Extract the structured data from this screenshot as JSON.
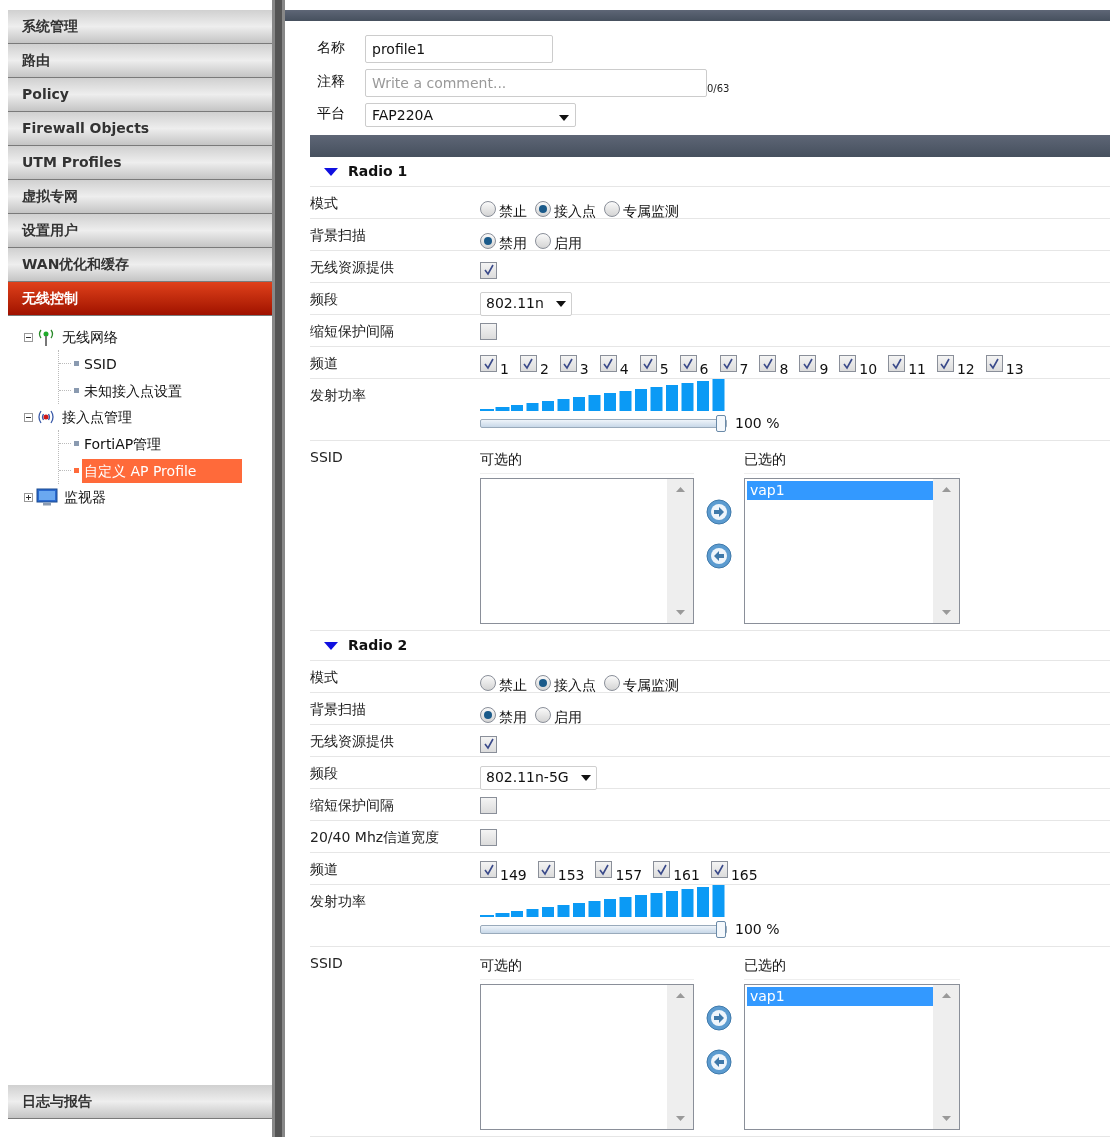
{
  "sidebar": {
    "menu": [
      {
        "label": "系统管理",
        "selected": false
      },
      {
        "label": "路由",
        "selected": false
      },
      {
        "label": "Policy",
        "selected": false
      },
      {
        "label": "Firewall Objects",
        "selected": false
      },
      {
        "label": "UTM Profiles",
        "selected": false
      },
      {
        "label": "虚拟专网",
        "selected": false
      },
      {
        "label": "设置用户",
        "selected": false
      },
      {
        "label": "WAN优化和缓存",
        "selected": false
      },
      {
        "label": "无线控制",
        "selected": true
      }
    ],
    "tree": [
      {
        "label": "无线网络",
        "kind": "antenna",
        "expanded": true,
        "children": [
          {
            "label": "SSID",
            "selected": false
          },
          {
            "label": "未知接入点设置",
            "selected": false
          }
        ]
      },
      {
        "label": "接入点管理",
        "kind": "ap",
        "expanded": true,
        "children": [
          {
            "label": "FortiAP管理",
            "selected": false
          },
          {
            "label": "自定义 AP Profile",
            "selected": true
          }
        ]
      },
      {
        "label": "监视器",
        "kind": "monitor",
        "expanded": false
      }
    ],
    "bottom_menu": [
      {
        "label": "日志与报告",
        "selected": false
      }
    ]
  },
  "form": {
    "name_label": "名称",
    "name_value": "profile1",
    "comment_label": "注释",
    "comment_placeholder": "Write a comment...",
    "comment_counter": "0/63",
    "platform_label": "平台",
    "platform_value": "FAP220A"
  },
  "radios": [
    {
      "title": "Radio 1",
      "expanded": true,
      "rows": [
        {
          "kind": "radio",
          "label": "模式",
          "options": [
            {
              "label": "禁止",
              "selected": false
            },
            {
              "label": "接入点",
              "selected": true
            },
            {
              "label": "专属监测",
              "selected": false
            }
          ]
        },
        {
          "kind": "radio",
          "label": "背景扫描",
          "options": [
            {
              "label": "禁用",
              "selected": true
            },
            {
              "label": "启用",
              "selected": false
            }
          ]
        },
        {
          "kind": "checkbox",
          "label": "无线资源提供",
          "checked": true
        },
        {
          "kind": "select",
          "label": "频段",
          "value": "802.11n"
        },
        {
          "kind": "checkbox",
          "label": "缩短保护间隔",
          "checked": false
        },
        {
          "kind": "channels",
          "label": "频道",
          "channels": [
            {
              "label": "1",
              "checked": true
            },
            {
              "label": "2",
              "checked": true
            },
            {
              "label": "3",
              "checked": true
            },
            {
              "label": "4",
              "checked": true
            },
            {
              "label": "5",
              "checked": true
            },
            {
              "label": "6",
              "checked": true
            },
            {
              "label": "7",
              "checked": true
            },
            {
              "label": "8",
              "checked": true
            },
            {
              "label": "9",
              "checked": true
            },
            {
              "label": "10",
              "checked": true
            },
            {
              "label": "11",
              "checked": true
            },
            {
              "label": "12",
              "checked": true
            },
            {
              "label": "13",
              "checked": true
            }
          ]
        },
        {
          "kind": "power",
          "label": "发射功率",
          "level": 1,
          "reading": "100 %"
        },
        {
          "kind": "ssid",
          "label": "SSID",
          "available_title": "可选的",
          "selected_title": "已选的",
          "chosen": [
            {
              "label": "vap1",
              "selected": true
            }
          ]
        }
      ]
    },
    {
      "title": "Radio 2",
      "expanded": true,
      "rows": [
        {
          "kind": "radio",
          "label": "模式",
          "options": [
            {
              "label": "禁止",
              "selected": false
            },
            {
              "label": "接入点",
              "selected": true
            },
            {
              "label": "专属监测",
              "selected": false
            }
          ]
        },
        {
          "kind": "radio",
          "label": "背景扫描",
          "options": [
            {
              "label": "禁用",
              "selected": true
            },
            {
              "label": "启用",
              "selected": false
            }
          ]
        },
        {
          "kind": "checkbox",
          "label": "无线资源提供",
          "checked": true
        },
        {
          "kind": "select",
          "label": "频段",
          "value": "802.11n-5G"
        },
        {
          "kind": "checkbox",
          "label": "缩短保护间隔",
          "checked": false
        },
        {
          "kind": "checkbox",
          "label": "20/40 Mhz信道宽度",
          "checked": false
        },
        {
          "kind": "channels",
          "label": "频道",
          "channels": [
            {
              "label": "149",
              "checked": true
            },
            {
              "label": "153",
              "checked": true
            },
            {
              "label": "157",
              "checked": true
            },
            {
              "label": "161",
              "checked": true
            },
            {
              "label": "165",
              "checked": true
            }
          ]
        },
        {
          "kind": "power",
          "label": "发射功率",
          "level": 1,
          "reading": "100 %"
        },
        {
          "kind": "ssid",
          "label": "SSID",
          "available_title": "可选的",
          "selected_title": "已选的",
          "chosen": [
            {
              "label": "vap1",
              "selected": true
            }
          ]
        }
      ]
    }
  ]
}
